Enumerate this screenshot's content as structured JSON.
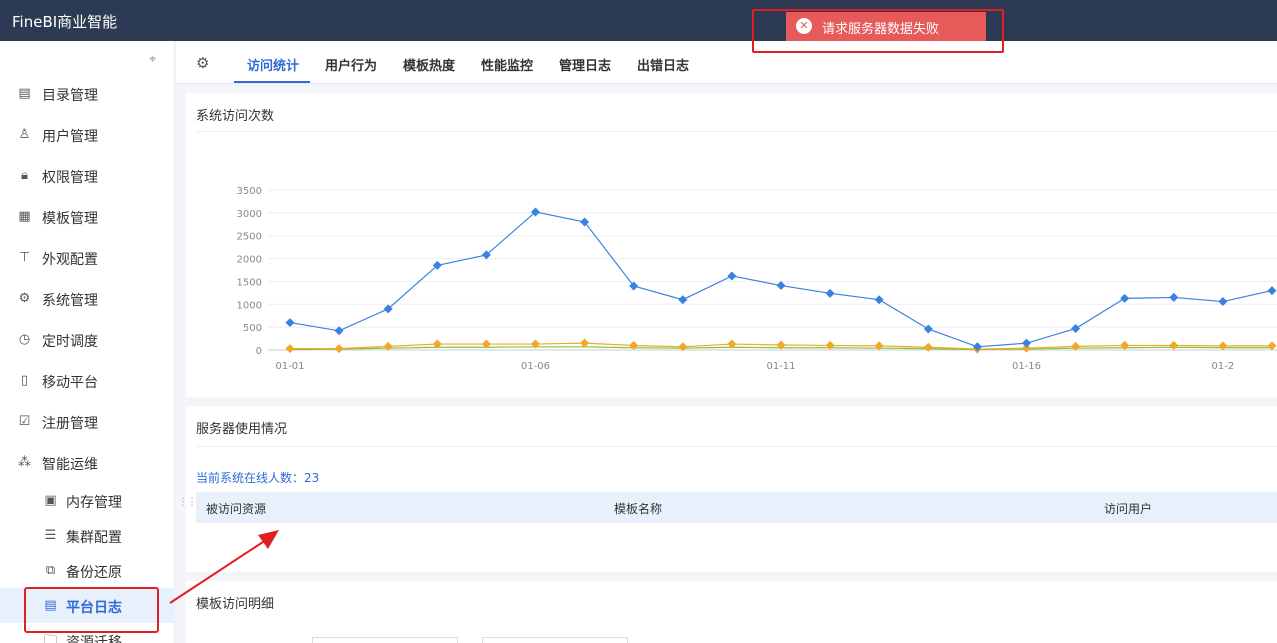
{
  "header": {
    "brand": "FineBI商业智能"
  },
  "toast": {
    "message": "请求服务器数据失败",
    "icon": "error-circle-icon",
    "color": "#e65a5a"
  },
  "sidebar": {
    "items": [
      {
        "label": "目录管理",
        "icon": "catalog-icon"
      },
      {
        "label": "用户管理",
        "icon": "user-icon"
      },
      {
        "label": "权限管理",
        "icon": "lock-icon"
      },
      {
        "label": "模板管理",
        "icon": "template-icon"
      },
      {
        "label": "外观配置",
        "icon": "paint-roller-icon"
      },
      {
        "label": "系统管理",
        "icon": "gear-icon"
      },
      {
        "label": "定时调度",
        "icon": "clock-icon"
      },
      {
        "label": "移动平台",
        "icon": "mobile-icon"
      },
      {
        "label": "注册管理",
        "icon": "register-icon"
      },
      {
        "label": "智能运维",
        "icon": "network-icon"
      }
    ],
    "subitems": [
      {
        "label": "内存管理",
        "icon": "memory-icon"
      },
      {
        "label": "集群配置",
        "icon": "cluster-icon"
      },
      {
        "label": "备份还原",
        "icon": "backup-icon"
      },
      {
        "label": "平台日志",
        "icon": "log-icon",
        "active": true
      },
      {
        "label": "资源迁移",
        "icon": "folder-icon"
      }
    ]
  },
  "tabs": {
    "items": [
      "访问统计",
      "用户行为",
      "模板热度",
      "性能监控",
      "管理日志",
      "出错日志"
    ],
    "active_index": 0
  },
  "visits_card": {
    "title": "系统访问次数"
  },
  "server_card": {
    "title": "服务器使用情况",
    "online_label": "当前系统在线人数：23",
    "columns": [
      "被访问资源",
      "模板名称",
      "访问用户"
    ]
  },
  "detail_card": {
    "title": "模板访问明细"
  },
  "chart_data": {
    "type": "line",
    "title": "系统访问次数",
    "ylim": [
      0,
      3500
    ],
    "yticks": [
      0,
      500,
      1000,
      1500,
      2000,
      2500,
      3000,
      3500
    ],
    "x": [
      "01-01",
      "01-02",
      "01-03",
      "01-04",
      "01-05",
      "01-06",
      "01-07",
      "01-08",
      "01-09",
      "01-10",
      "01-11",
      "01-12",
      "01-13",
      "01-14",
      "01-15",
      "01-16",
      "01-17",
      "01-18",
      "01-19",
      "01-20",
      "01-21"
    ],
    "xtick_labels": [
      "01-01",
      "01-06",
      "01-11",
      "01-16",
      "01-2"
    ],
    "grid": true,
    "series": [
      {
        "color": "#3b82e0",
        "marker": "diamond",
        "values": [
          600,
          420,
          900,
          1850,
          2080,
          3020,
          2800,
          1400,
          1100,
          1620,
          1410,
          1240,
          1100,
          460,
          70,
          150,
          470,
          1130,
          1150,
          1060,
          1300
        ]
      },
      {
        "color": "#f5a623",
        "marker": "diamond",
        "values": [
          30,
          30,
          80,
          130,
          130,
          130,
          150,
          100,
          70,
          130,
          110,
          100,
          90,
          60,
          20,
          40,
          80,
          100,
          100,
          90,
          90
        ]
      },
      {
        "color": "#7ac943",
        "marker": "none",
        "values": [
          10,
          20,
          40,
          60,
          60,
          70,
          70,
          50,
          40,
          60,
          50,
          50,
          40,
          30,
          10,
          20,
          40,
          50,
          60,
          50,
          50
        ]
      }
    ]
  }
}
